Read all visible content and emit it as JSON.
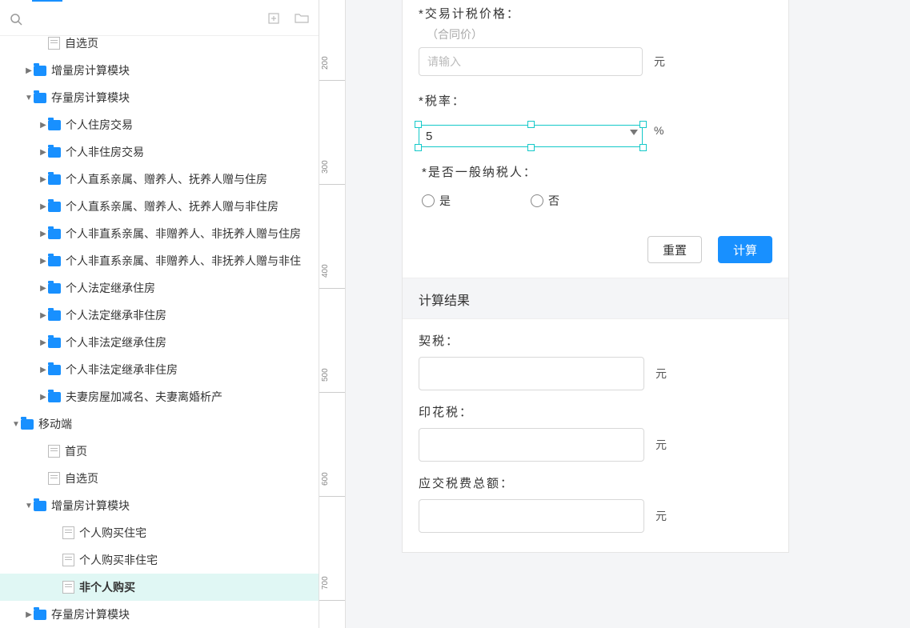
{
  "search": {
    "placeholder": ""
  },
  "tree": [
    {
      "indent": 48,
      "expand": "none",
      "icon": "page",
      "label": "自选页",
      "partial": true
    },
    {
      "indent": 30,
      "expand": "col",
      "icon": "folder",
      "label": "增量房计算模块"
    },
    {
      "indent": 30,
      "expand": "exp",
      "icon": "folder",
      "label": "存量房计算模块"
    },
    {
      "indent": 48,
      "expand": "col",
      "icon": "folder",
      "label": "个人住房交易"
    },
    {
      "indent": 48,
      "expand": "col",
      "icon": "folder",
      "label": "个人非住房交易"
    },
    {
      "indent": 48,
      "expand": "col",
      "icon": "folder",
      "label": "个人直系亲属、赠养人、抚养人赠与住房"
    },
    {
      "indent": 48,
      "expand": "col",
      "icon": "folder",
      "label": "个人直系亲属、赠养人、抚养人赠与非住房"
    },
    {
      "indent": 48,
      "expand": "col",
      "icon": "folder",
      "label": "个人非直系亲属、非赠养人、非抚养人赠与住房"
    },
    {
      "indent": 48,
      "expand": "col",
      "icon": "folder",
      "label": "个人非直系亲属、非赠养人、非抚养人赠与非住"
    },
    {
      "indent": 48,
      "expand": "col",
      "icon": "folder",
      "label": "个人法定继承住房"
    },
    {
      "indent": 48,
      "expand": "col",
      "icon": "folder",
      "label": "个人法定继承非住房"
    },
    {
      "indent": 48,
      "expand": "col",
      "icon": "folder",
      "label": "个人非法定继承住房"
    },
    {
      "indent": 48,
      "expand": "col",
      "icon": "folder",
      "label": "个人非法定继承非住房"
    },
    {
      "indent": 48,
      "expand": "col",
      "icon": "folder",
      "label": "夫妻房屋加减名、夫妻离婚析产"
    },
    {
      "indent": 14,
      "expand": "exp",
      "icon": "folder",
      "label": "移动端"
    },
    {
      "indent": 48,
      "expand": "none",
      "icon": "page",
      "label": "首页"
    },
    {
      "indent": 48,
      "expand": "none",
      "icon": "page",
      "label": "自选页"
    },
    {
      "indent": 30,
      "expand": "exp",
      "icon": "folder",
      "label": "增量房计算模块"
    },
    {
      "indent": 66,
      "expand": "none",
      "icon": "page",
      "label": "个人购买住宅"
    },
    {
      "indent": 66,
      "expand": "none",
      "icon": "page",
      "label": "个人购买非住宅"
    },
    {
      "indent": 66,
      "expand": "none",
      "icon": "page",
      "label": "非个人购买",
      "selected": true
    },
    {
      "indent": 30,
      "expand": "col",
      "icon": "folder",
      "label": "存量房计算模块"
    }
  ],
  "form": {
    "price_label": "*交易计税价格：",
    "price_sub": "（合同价）",
    "price_placeholder": "请输入",
    "unit_yuan": "元",
    "rate_label": "*税率：",
    "rate_value": "5",
    "rate_unit": "%",
    "taxpayer_label": "*是否一般纳税人：",
    "opt_yes": "是",
    "opt_no": "否",
    "btn_reset": "重置",
    "btn_calc": "计算",
    "result_title": "计算结果",
    "out1_label": "契税：",
    "out2_label": "印花税：",
    "out3_label": "应交税费总额："
  },
  "ruler_ticks": [
    {
      "pos": 100,
      "label": "200"
    },
    {
      "pos": 230,
      "label": "300"
    },
    {
      "pos": 360,
      "label": "400"
    },
    {
      "pos": 490,
      "label": "500"
    },
    {
      "pos": 620,
      "label": "600"
    },
    {
      "pos": 750,
      "label": "700"
    }
  ]
}
